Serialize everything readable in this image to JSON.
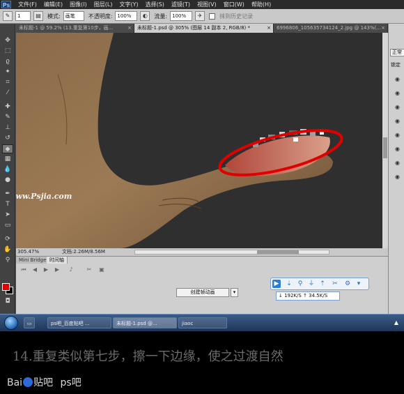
{
  "menubar": {
    "logo": "Ps",
    "items": [
      "文件(F)",
      "编辑(E)",
      "图像(I)",
      "图层(L)",
      "文字(Y)",
      "选择(S)",
      "滤镜(T)",
      "视图(V)",
      "窗口(W)",
      "帮助(H)"
    ]
  },
  "options": {
    "brush_size": "1",
    "mode_label": "模式:",
    "mode_value": "画笔",
    "opacity_label": "不透明度:",
    "opacity_value": "100%",
    "flow_label": "流量:",
    "flow_value": "100%",
    "history_label": "抹到历史记录"
  },
  "tabs": [
    {
      "label": "未标题-1 @ 59.2% (13.重复第10步，画...",
      "close": "×"
    },
    {
      "label": "未标题-1.psd @ 305% (图层 14 副本 2, RGB/8) *",
      "close": "×"
    },
    {
      "label": "6996806_105635734124_2.jpg @ 143%(...",
      "close": "×"
    }
  ],
  "canvas": {
    "watermark": "www.Psjia.com"
  },
  "status": {
    "zoom": "305.47%",
    "doc": "文档:2.26M/8.56M"
  },
  "panel": {
    "tabs": [
      "Mini Bridge",
      "时间轴"
    ],
    "create_button": "创建帧动画",
    "speed_text": "↓ 192K/S  ↑ 34.5K/S"
  },
  "right_panel": {
    "button": "正常",
    "lock": "锁定"
  },
  "taskbar": {
    "items": [
      "ps吧_百度贴吧 ...",
      "未标题-1.psd @...",
      "jiaoc"
    ],
    "tray": "▲"
  },
  "caption": "14.重复类似第七步，擦一下边缘，使之过渡自然",
  "watermark": {
    "text_left": "Bai",
    "text_mid": "贴吧",
    "text_right": "ps吧"
  },
  "colors": {
    "foreground": "#e00000",
    "background": "#000000",
    "highlight_ellipse": "#e00000"
  }
}
